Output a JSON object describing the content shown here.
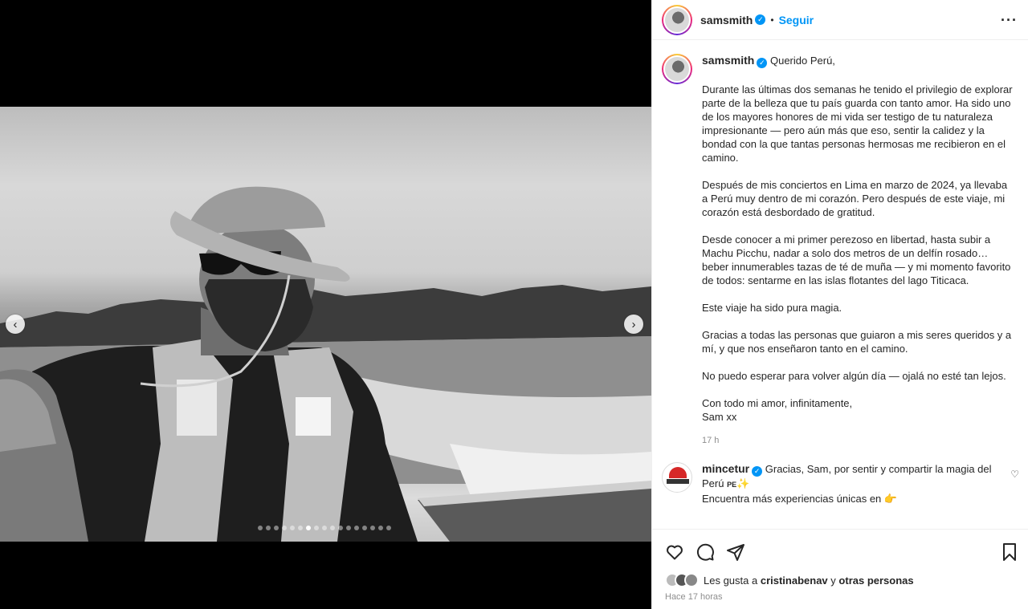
{
  "carousel": {
    "slide_count": 17,
    "active_index": 6,
    "prev_icon": "chevron-left-icon",
    "next_icon": "chevron-right-icon"
  },
  "header": {
    "username": "samsmith",
    "separator": "•",
    "follow_label": "Seguir",
    "more_icon": "more-horizontal-icon"
  },
  "caption": {
    "username": "samsmith",
    "first_line": "Querido Perú,",
    "paragraphs": [
      "Durante las últimas dos semanas he tenido el privilegio de explorar parte de la belleza que tu país guarda con tanto amor. Ha sido uno de los mayores honores de mi vida ser testigo de tu naturaleza impresionante — pero aún más que eso, sentir la calidez y la bondad con la que tantas personas hermosas me recibieron en el camino.",
      "Después de mis conciertos en Lima en marzo de 2024, ya llevaba a Perú muy dentro de mi corazón. Pero después de este viaje, mi corazón está desbordado de gratitud.",
      "Desde conocer a mi primer perezoso en libertad, hasta subir a Machu Picchu, nadar a solo dos metros de un delfín rosado… beber innumerables tazas de té de muña — y mi momento favorito de todos: sentarme en las islas flotantes del lago Titicaca.",
      "Este viaje ha sido pura magia.",
      "Gracias a todas las personas que guiaron a mis seres queridos y a mí, y que nos enseñaron tanto en el camino.",
      "No puedo esperar para volver algún día — ojalá no esté tan lejos.",
      "Con todo mi amor, infinitamente,"
    ],
    "signature": "Sam xx",
    "time": "17 h"
  },
  "comment": {
    "username": "mincetur",
    "avatar_label": "MINCETUR",
    "line1": "Gracias, Sam, por sentir y compartir la magia del",
    "line2_text": "Perú",
    "line2_flag": "PE",
    "line2_emoji": "✨",
    "line3": "Encuentra más experiencias únicas en",
    "line3_emoji": "👉"
  },
  "actions": {
    "like_icon": "heart-icon",
    "comment_icon": "comment-icon",
    "share_icon": "share-icon",
    "save_icon": "bookmark-icon"
  },
  "likes": {
    "prefix": "Les gusta a",
    "user": "cristinabenav",
    "joiner": "y",
    "others": "otras personas"
  },
  "posted": "Hace 17 horas",
  "colors": {
    "accent": "#0095f6",
    "text": "#262626",
    "muted": "#8e8e8e"
  }
}
